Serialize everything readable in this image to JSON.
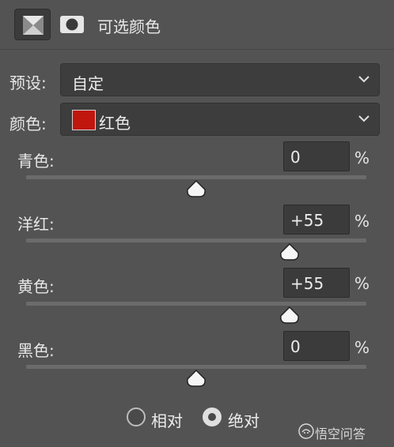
{
  "header": {
    "title": "可选颜色",
    "adjustment_icon": "selective-color-adjustment-icon",
    "mask_icon": "layer-mask-icon"
  },
  "preset": {
    "label": "预设:",
    "value": "自定",
    "icon": "chevron-down-icon"
  },
  "colors": {
    "label": "颜色:",
    "value": "红色",
    "swatch_color": "#c0160e",
    "icon": "chevron-down-icon"
  },
  "sliders": [
    {
      "label": "青色:",
      "value": "0",
      "unit": "%",
      "level": 0
    },
    {
      "label": "洋红:",
      "value": "+55",
      "unit": "%",
      "level": 55
    },
    {
      "label": "黄色:",
      "value": "+55",
      "unit": "%",
      "level": 55
    },
    {
      "label": "黑色:",
      "value": "0",
      "unit": "%",
      "level": 0
    }
  ],
  "method": {
    "options": [
      {
        "label": "相对",
        "selected": false
      },
      {
        "label": "绝对",
        "selected": true
      }
    ]
  },
  "watermark": {
    "text": "悟空问答"
  }
}
